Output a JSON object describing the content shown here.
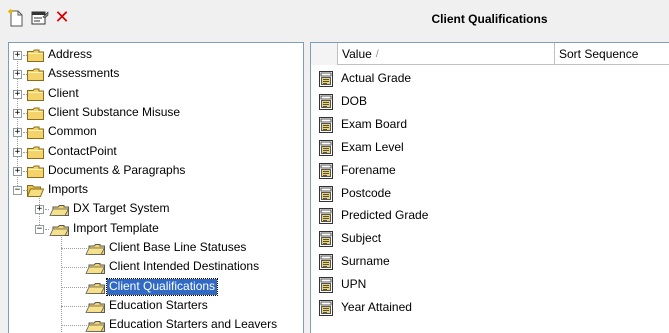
{
  "toolbar": {
    "new_icon": "new-document-icon",
    "properties_icon": "properties-icon",
    "delete_icon": "delete-icon",
    "delete_glyph": "✕"
  },
  "title": "Client Qualifications",
  "tree": {
    "items": [
      {
        "label": "Address",
        "expander": "+"
      },
      {
        "label": "Assessments",
        "expander": "+"
      },
      {
        "label": "Client",
        "expander": "+"
      },
      {
        "label": "Client Substance Misuse",
        "expander": "+"
      },
      {
        "label": "Common",
        "expander": "+"
      },
      {
        "label": "ContactPoint",
        "expander": "+"
      },
      {
        "label": "Documents & Paragraphs",
        "expander": "+"
      },
      {
        "label": "Imports",
        "expander": "−"
      },
      {
        "label": "DX Target System",
        "expander": "+"
      },
      {
        "label": "Import Template",
        "expander": "−"
      },
      {
        "label": "Client Base Line Statuses"
      },
      {
        "label": "Client Intended Destinations"
      },
      {
        "label": "Client Qualifications",
        "selected": true
      },
      {
        "label": "Education Starters"
      },
      {
        "label": "Education Starters and Leavers"
      }
    ]
  },
  "list": {
    "columns": {
      "value": "Value",
      "sort_sequence": "Sort Sequence",
      "sort_indicator": "/"
    },
    "rows": [
      "Actual Grade",
      "DOB",
      "Exam Board",
      "Exam Level",
      "Forename",
      "Postcode",
      "Predicted Grade",
      "Subject",
      "Surname",
      "UPN",
      "Year Attained"
    ]
  },
  "colors": {
    "selection": "#316ac5",
    "folder": "#f3d36a",
    "delete": "#d40000"
  }
}
